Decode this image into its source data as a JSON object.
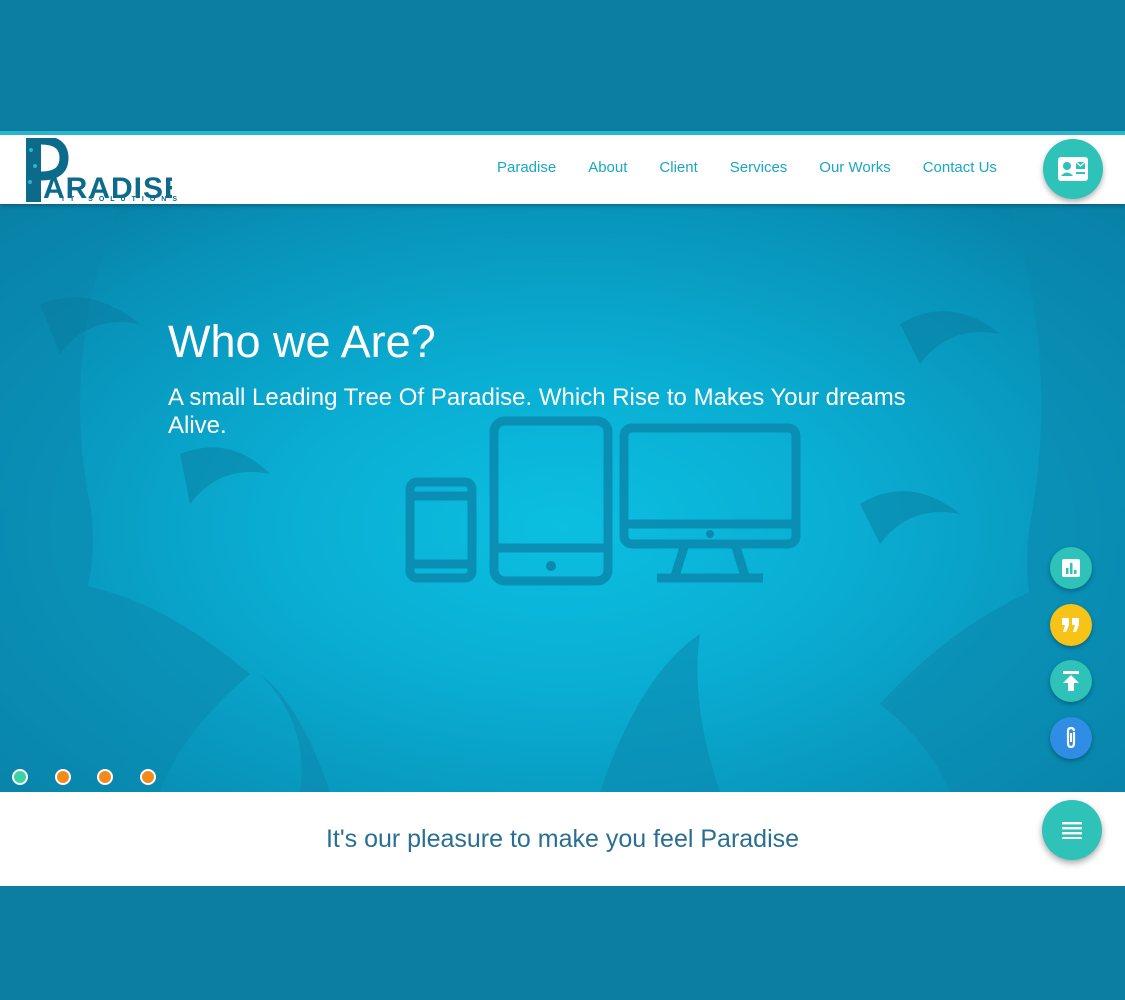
{
  "brand": {
    "logo_text": "PARADISE",
    "logo_subtitle": "IT SOLUTIONS"
  },
  "nav": {
    "items": [
      {
        "label": "Paradise"
      },
      {
        "label": "About"
      },
      {
        "label": "Client"
      },
      {
        "label": "Services"
      },
      {
        "label": "Our Works"
      },
      {
        "label": "Contact Us"
      }
    ],
    "contact_icon": "contact-card-icon"
  },
  "hero": {
    "title": "Who we Are?",
    "text": "A small Leading Tree Of Paradise. Which Rise to Makes Your dreams Alive.",
    "illustration": "devices-icon",
    "slides": [
      {
        "color": "#3ad3a3",
        "active": true
      },
      {
        "color": "#f28a1c",
        "active": false
      },
      {
        "color": "#f28a1c",
        "active": false
      },
      {
        "color": "#f28a1c",
        "active": false
      }
    ]
  },
  "side_actions": [
    {
      "icon": "bar-chart-icon",
      "color": "#2ec2b8"
    },
    {
      "icon": "quote-icon",
      "color": "#f6c316"
    },
    {
      "icon": "arrow-up-to-top-icon",
      "color": "#2ec2b8"
    },
    {
      "icon": "paperclip-icon",
      "color": "#2f8de4"
    }
  ],
  "tagline": "It's our pleasure to make you feel Paradise",
  "menu_icon": "menu-lines-icon",
  "colors": {
    "accent": "#2ec2b8",
    "nav_text": "#1aa7c0",
    "page_bg": "#0b7ea2",
    "tagline_text": "#2a6f92"
  }
}
